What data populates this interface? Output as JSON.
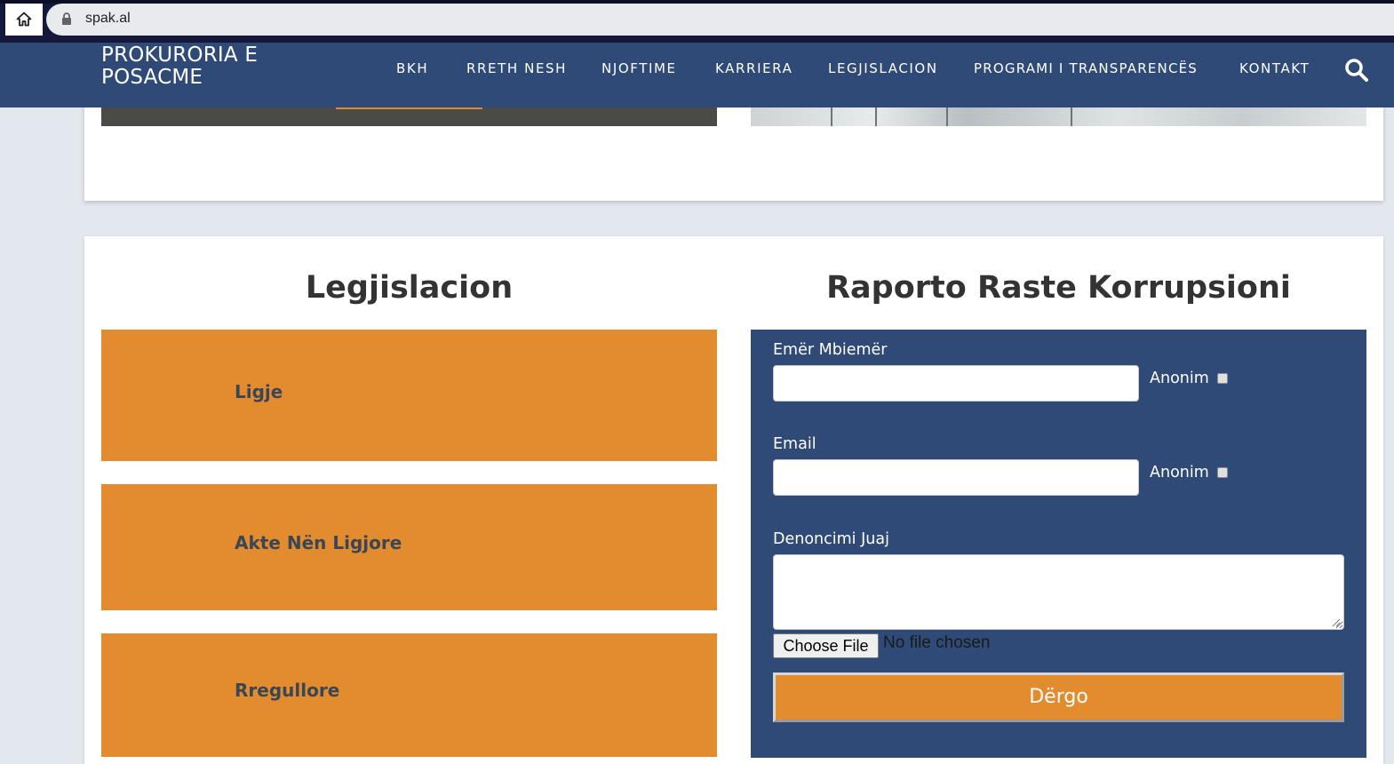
{
  "browser": {
    "url": "spak.al",
    "home_icon": "home-icon",
    "lock_icon": "lock-icon"
  },
  "header": {
    "logo_line1": "PROKURORIA E",
    "logo_line2": "POSACME",
    "nav": [
      "BKH",
      "RRETH NESH",
      "NJOFTIME",
      "KARRIERA",
      "LEGJISLACION",
      "PROGRAMI I TRANSPARENCËS",
      "KONTAKT"
    ],
    "search_icon": "search-icon"
  },
  "legjislacion": {
    "title": "Legjislacion",
    "items": [
      "Ligje",
      "Akte Nën Ligjore",
      "Rregullore"
    ]
  },
  "report": {
    "title": "Raporto Raste Korrupsioni",
    "name_label": "Emër Mbiemër",
    "name_value": "",
    "anonim_label": "Anonim",
    "email_label": "Email",
    "email_value": "",
    "report_label": "Denoncimi Juaj",
    "report_value": "",
    "file_button": "Choose File",
    "file_status": "No file chosen",
    "submit": "Dërgo"
  },
  "colors": {
    "header_blue": "#2f4a77",
    "accent_orange": "#e38b2f",
    "page_bg": "#e3e7ee"
  }
}
